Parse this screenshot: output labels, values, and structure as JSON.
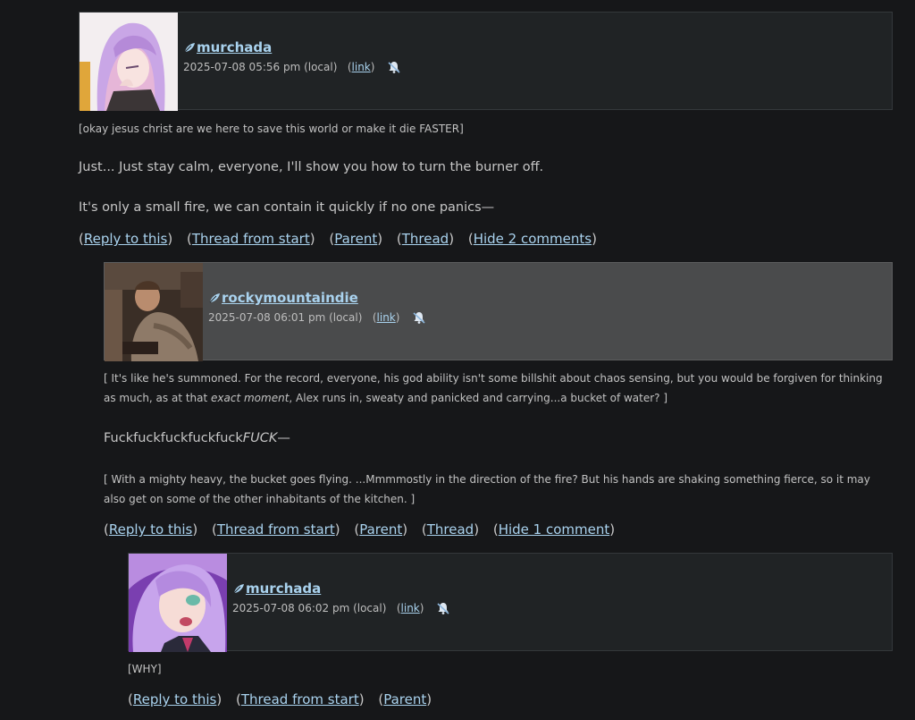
{
  "comments": [
    {
      "username": "murchada",
      "datetime": "2025-07-08 05:56 pm (local)",
      "link_label": "link",
      "lines": [
        {
          "text": "[okay jesus christ are we here to save this world or make it die FASTER]"
        },
        {
          "text": "Just... Just stay calm, everyone, I'll show you how to turn the burner off."
        },
        {
          "text": "It's only a small fire, we can contain it quickly if no one panics—"
        }
      ],
      "actions": {
        "reply": "Reply to this",
        "thread_start": "Thread from start",
        "parent": "Parent",
        "thread": "Thread",
        "hide": "Hide 2 comments"
      }
    },
    {
      "username": "rockymountaindie",
      "datetime": "2025-07-08 06:01 pm (local)",
      "link_label": "link",
      "lines": [
        {
          "text": "[ It's like he's summoned. For the record, everyone, his god ability isn't some billshit about chaos sensing, but you would be forgiven for thinking"
        },
        {
          "pre": "as much, as at that ",
          "em": "exact moment",
          "post": ", Alex runs in, sweaty and panicked and carrying...a bucket of water? ]"
        },
        {
          "pre": "Fuckfuckfuckfuckfuck",
          "em": "FUCK",
          "post": "—"
        },
        {
          "text": "[ With a mighty heavy, the bucket goes flying. ...Mmmmostly in the direction of the fire? But his hands are shaking something fierce, so it may"
        },
        {
          "text": "also get on some of the other inhabitants of the kitchen. ]"
        }
      ],
      "actions": {
        "reply": "Reply to this",
        "thread_start": "Thread from start",
        "parent": "Parent",
        "thread": "Thread",
        "hide": "Hide 1 comment"
      }
    },
    {
      "username": "murchada",
      "datetime": "2025-07-08 06:02 pm (local)",
      "link_label": "link",
      "lines": [
        {
          "text": "[WHY]"
        }
      ],
      "actions": {
        "reply": "Reply to this",
        "thread_start": "Thread from start",
        "parent": "Parent"
      }
    }
  ],
  "colors": {
    "background": "#161719",
    "header": "#202325",
    "header_highlight": "#4a4b4c",
    "link": "#a9d2ee"
  },
  "icons": {
    "user": "user-feather-icon",
    "mute": "mute-bell-icon"
  }
}
